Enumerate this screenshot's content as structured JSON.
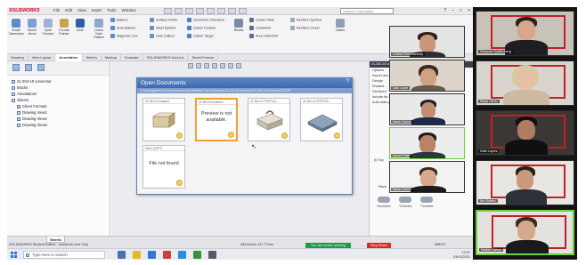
{
  "app": {
    "logo": "SOLIDWORKS",
    "menu": [
      "File",
      "Edit",
      "View",
      "Insert",
      "Tools",
      "Window"
    ],
    "search_placeholder": "Search Commands",
    "window_buttons": [
      "?",
      "–",
      "□",
      "×"
    ]
  },
  "ribbon": {
    "big_buttons": [
      {
        "label": "Smart Dimension",
        "icon": "smart-dimension-icon"
      },
      {
        "label": "Model Items",
        "icon": "model-items-icon"
      },
      {
        "label": "Spell Checker",
        "icon": "spell-checker-icon"
      },
      {
        "label": "Format Painter",
        "icon": "format-painter-icon"
      },
      {
        "label": "Note",
        "icon": "note-icon"
      },
      {
        "label": "Linear Note Pattern",
        "icon": "linear-note-pattern-icon"
      }
    ],
    "small_rows": [
      [
        "Balloon",
        "Auto Balloon",
        "Magnetic Line"
      ],
      [
        "Surface Finish",
        "Weld Symbol",
        "Hole Callout"
      ],
      [
        "Geometric Tolerance",
        "Datum Feature",
        "Datum Target"
      ]
    ],
    "blocks_label": "Blocks",
    "center_rows": [
      "Center Mark",
      "Centerline",
      "Area Hatch/Fill"
    ],
    "revision_rows": [
      "Revision Symbol",
      "Revision Cloud"
    ],
    "tables_label": "Tables"
  },
  "tabs": [
    "Drawing",
    "View Layout",
    "Annotation",
    "Sketch",
    "Markup",
    "Evaluate",
    "SOLIDWORKS Add-Ins",
    "Sheet Format"
  ],
  "active_tab": "Annotation",
  "tree": [
    "21-304-10 connector",
    "Blocks",
    "Annotations",
    "Sheet1",
    "Sheet Format1",
    "Drawing View1",
    "Drawing View2",
    "Drawing View3"
  ],
  "dialog": {
    "title": "Open Documents",
    "help": "?",
    "path": "C:\\Users\\gabriel\\OneDrive\\Documents\\SolidWorks 2021\\Solidworks 21-304-10 Connector\\21-304-10 connector.SLDPRT",
    "docs": [
      {
        "label": "21-304-10 connect...",
        "message": ""
      },
      {
        "label": "21-304-10 connect...",
        "message": "Preview is not available."
      },
      {
        "label": "21-304-10 TOP PLA...",
        "message": ""
      },
      {
        "label": "21-304-10 TOP PLA...",
        "message": ""
      },
      {
        "label": "Part 1 (LEFT)",
        "message": "File not found"
      }
    ]
  },
  "property_panel": {
    "title": "21-304-10 connector",
    "rows": [
      "Options",
      "Import ann...",
      "Design",
      "Shaded...",
      "DimXpert",
      "Include ite...",
      "Auto-start pro..."
    ],
    "view_label": "(f) Top",
    "view_items": [
      "*Isometric",
      "*Dimetric",
      "*Trimetric"
    ],
    "back_label": "*Back"
  },
  "status": {
    "sheet_tab": "Sheet1",
    "left_text": "SOLIDWORKS Student Edition - Academic Use Only",
    "coords": "283.44mm   137.77mm",
    "sharing": "You are screen sharing",
    "stop": "Stop Share",
    "units": "MMGS"
  },
  "taskbar": {
    "search_placeholder": "Type here to search",
    "time": "19:57",
    "date": "03/03/2021"
  },
  "participants_overlay": [
    {
      "name": "Chaitan Tirumalareddy",
      "speaking": false
    },
    {
      "name": "Gabi Lopes",
      "speaking": false
    },
    {
      "name": "Nadav Sahon",
      "speaking": false
    },
    {
      "name": "Daniel Pirkel",
      "speaking": true
    },
    {
      "name": "Nadav Sahon",
      "speaking": false
    }
  ],
  "gallery": [
    {
      "name": "Shachar Goldenberg",
      "speaking": false
    },
    {
      "name": "Maya Ofner",
      "speaking": false
    },
    {
      "name": "Gabi Lopes",
      "speaking": false
    },
    {
      "name": "Ido Rotem",
      "speaking": false
    },
    {
      "name": "Nadav Sahon",
      "speaking": true
    }
  ],
  "colors": {
    "accent_blue": "#3e6aad",
    "speaking_green": "#6fd136",
    "frame_red": "#c41e2a",
    "share_green": "#1f9a4a",
    "stop_red": "#d62b2b"
  }
}
